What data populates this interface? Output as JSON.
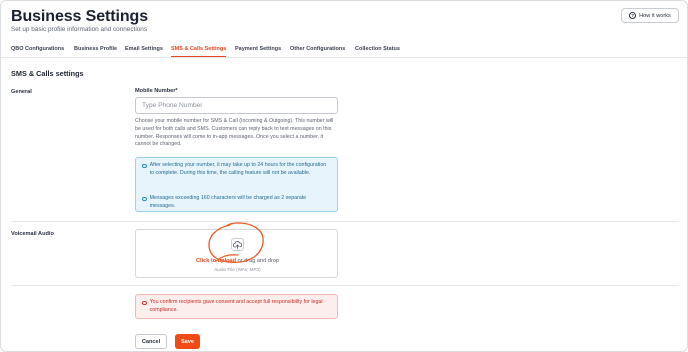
{
  "header": {
    "title": "Business Settings",
    "subtitle": "Set up basic profile information and connections",
    "help_button": "How it works"
  },
  "tabs": [
    {
      "label": "QBO Configurations",
      "active": false
    },
    {
      "label": "Business Profile",
      "active": false
    },
    {
      "label": "Email Settings",
      "active": false
    },
    {
      "label": "SMS & Calls Settings",
      "active": true
    },
    {
      "label": "Payment Settings",
      "active": false
    },
    {
      "label": "Other Configurations",
      "active": false
    },
    {
      "label": "Collection Status",
      "active": false
    }
  ],
  "section_title": "SMS & Calls settings",
  "general": {
    "label": "General",
    "field_label": "Mobile Number*",
    "input_placeholder": "Type Phone Number",
    "input_value": "",
    "help_text": "Choose your mobile number for SMS & Call (Incoming & Outgoing). This number will be used for both calls and SMS. Customers can reply back to text messages on this number. Responses will come to in-app messages. Once you select a number, it cannot be changed.",
    "info": [
      "After selecting your number, it may take up to 24 hours for the configuration to complete. During this time, the calling feature will not be available.",
      "Messages exceeding 160 characters will be charged as 2 separate messages."
    ]
  },
  "voicemail": {
    "label": "Voicemail Audio",
    "upload_link": "Click to upload",
    "upload_rest": " or drag and drop",
    "upload_hint": "Audio File (WAV, MP3)"
  },
  "consent_warning": "You confirm recipients gave consent and accept full responsibility for legal compliance.",
  "actions": {
    "cancel": "Cancel",
    "save": "Save"
  },
  "colors": {
    "accent": "#e8471e",
    "save_button": "#f04a17",
    "info_bg": "#e8f4fb",
    "warning_bg": "#fdeeee"
  }
}
